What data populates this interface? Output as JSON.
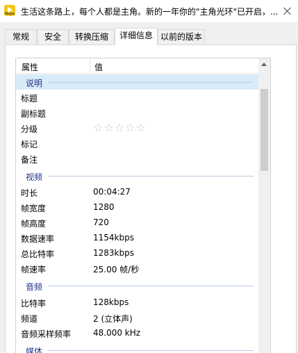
{
  "window": {
    "title": "生活这条路上，每个人都是主角。新的一年你的\"主角光环\"已开启，...",
    "app_icon_tag": "Player"
  },
  "tabs": [
    {
      "label": "常规"
    },
    {
      "label": "安全"
    },
    {
      "label": "转换压缩"
    },
    {
      "label": "详细信息"
    },
    {
      "label": "以前的版本"
    }
  ],
  "active_tab": "详细信息",
  "list": {
    "header": {
      "name": "属性",
      "value": "值"
    },
    "groups": {
      "description": {
        "label": "说明",
        "rows": [
          {
            "name": "标题",
            "value": ""
          },
          {
            "name": "副标题",
            "value": ""
          },
          {
            "name": "分级",
            "value": ""
          },
          {
            "name": "标记",
            "value": ""
          },
          {
            "name": "备注",
            "value": ""
          }
        ],
        "rating": {
          "stars_total": 5,
          "stars_filled": 0,
          "glyphs": "☆☆☆☆☆"
        }
      },
      "video": {
        "label": "视频",
        "rows": [
          {
            "name": "时长",
            "value": "00:04:27"
          },
          {
            "name": "帧宽度",
            "value": "1280"
          },
          {
            "name": "帧高度",
            "value": "720"
          },
          {
            "name": "数据速率",
            "value": "1154kbps"
          },
          {
            "name": "总比特率",
            "value": "1283kbps"
          },
          {
            "name": "帧速率",
            "value": "25.00 帧/秒"
          }
        ]
      },
      "audio": {
        "label": "音频",
        "rows": [
          {
            "name": "比特率",
            "value": "128kbps"
          },
          {
            "name": "频道",
            "value": "2 (立体声)"
          },
          {
            "name": "音频采样频率",
            "value": "48.000 kHz"
          }
        ]
      },
      "media": {
        "label": "媒体"
      }
    }
  }
}
